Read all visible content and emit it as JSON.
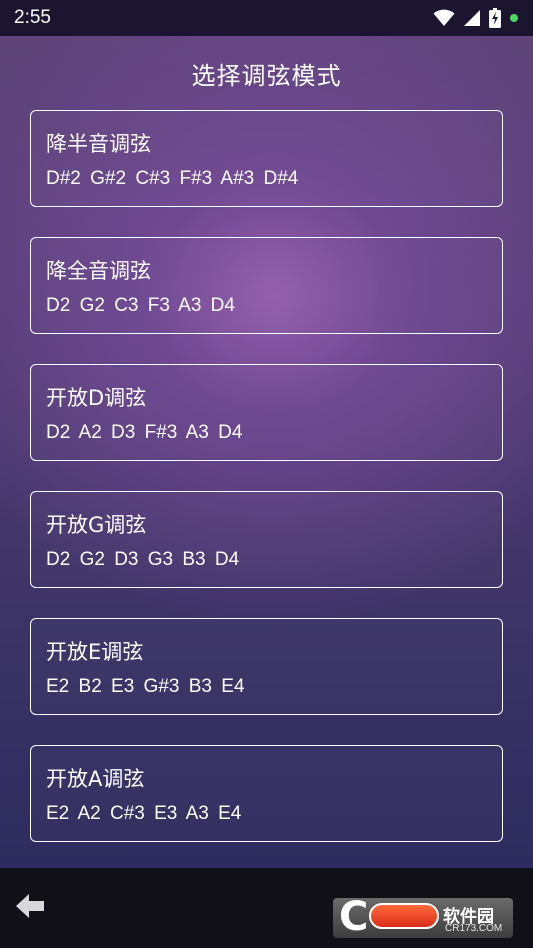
{
  "status_bar": {
    "time": "2:55",
    "icons": [
      "wifi-icon",
      "signal-icon",
      "battery-charging-icon",
      "notification-dot-icon"
    ],
    "dot_color": "#4cd964"
  },
  "page": {
    "title": "选择调弦模式"
  },
  "modes": [
    {
      "name": "降半音调弦",
      "notes": "D#2 G#2 C#3 F#3 A#3 D#4"
    },
    {
      "name": "降全音调弦",
      "notes": "D2 G2 C3 F3 A3 D4"
    },
    {
      "name": "开放D调弦",
      "notes": "D2 A2 D3 F#3 A3 D4"
    },
    {
      "name": "开放G调弦",
      "notes": "D2 G2 D3 G3 B3 D4"
    },
    {
      "name": "开放E调弦",
      "notes": "E2 B2 E3 G#3 B3 E4"
    },
    {
      "name": "开放A调弦",
      "notes": "E2 A2 C#3 E3 A3 E4"
    }
  ],
  "bottom_bar": {
    "back_icon": "arrow-left-icon"
  },
  "watermark": {
    "brand": "软件园",
    "domain": "CR173.COM",
    "pill_color": "#e63c1e"
  }
}
